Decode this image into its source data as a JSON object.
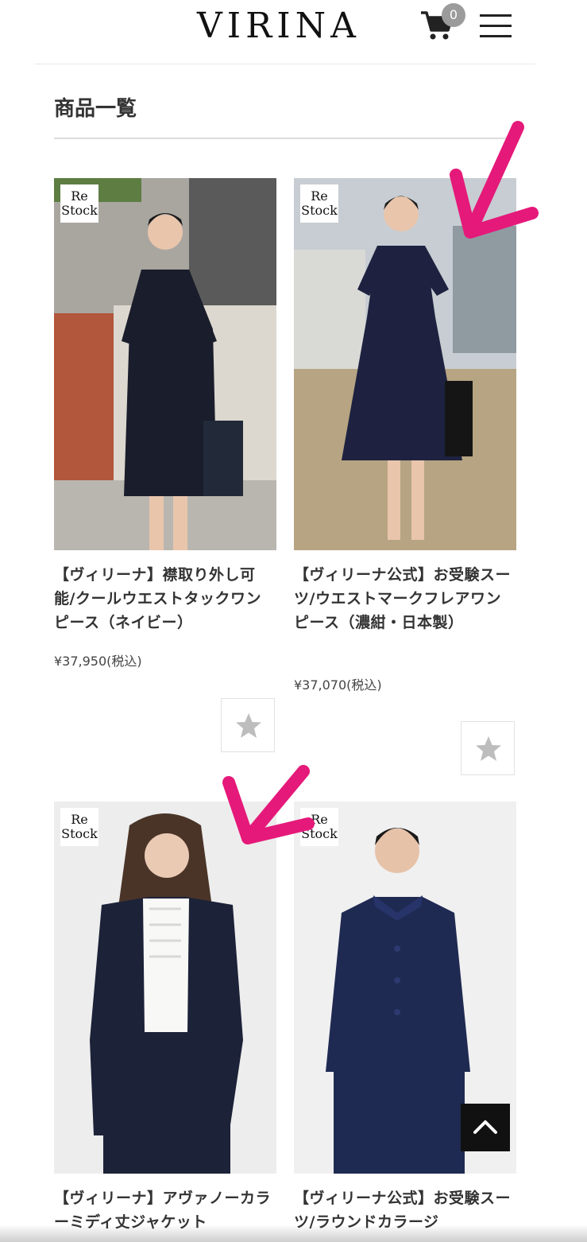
{
  "header": {
    "logo": "VIRINA",
    "cart_count": "0",
    "cart_icon": "cart-icon",
    "menu_icon": "hamburger-menu-icon"
  },
  "section": {
    "title": "商品一覧"
  },
  "products": [
    {
      "badge": "Re Stock",
      "badge_line1": "Re",
      "badge_line2": "Stock",
      "name": "【ヴィリーナ】襟取り外し可能/クールウエストタックワンピース（ネイビー）",
      "price": "¥37,950(税込)",
      "color": "#1a1d2b"
    },
    {
      "badge": "Re Stock",
      "badge_line1": "Re",
      "badge_line2": "Stock",
      "name": "【ヴィリーナ公式】お受験スーツ/ウエストマークフレアワンピース（濃紺・日本製）",
      "price": "¥37,070(税込)",
      "color": "#1e2240"
    },
    {
      "badge": "Re Stock",
      "badge_line1": "Re",
      "badge_line2": "Stock",
      "name": "【ヴィリーナ】アヴァノーカラーミディ丈ジャケット",
      "color": "#1c2238"
    },
    {
      "badge": "Re Stock",
      "badge_line1": "Re",
      "badge_line2": "Stock",
      "name": "【ヴィリーナ公式】お受験スーツ/ラウンドカラージ",
      "color": "#1f2a52"
    }
  ],
  "icons": {
    "favorite": "star-icon",
    "scroll_top": "chevron-up-icon"
  },
  "colors": {
    "annotation_arrow": "#e5197a",
    "brand": "#111111"
  }
}
